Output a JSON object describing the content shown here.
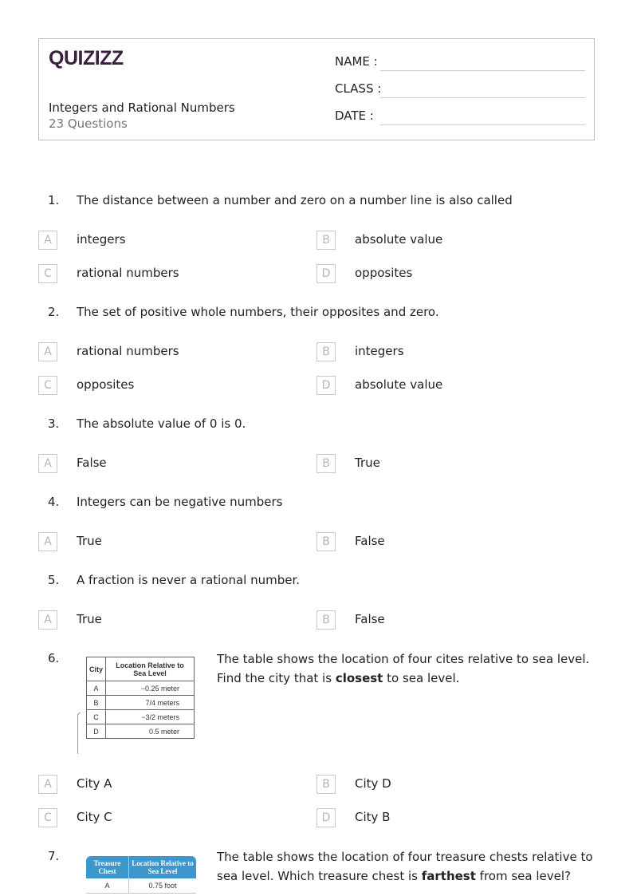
{
  "header": {
    "logo": "QUIZIZZ",
    "title": "Integers and Rational Numbers",
    "subtitle": "23 Questions",
    "fields": {
      "name": "NAME :",
      "class": "CLASS :",
      "date": "DATE  :"
    }
  },
  "questions": [
    {
      "num": "1.",
      "text": "The distance between a number and zero on a number line is also called",
      "options": [
        {
          "letter": "A",
          "text": "integers"
        },
        {
          "letter": "B",
          "text": "absolute value"
        },
        {
          "letter": "C",
          "text": "rational numbers"
        },
        {
          "letter": "D",
          "text": "opposites"
        }
      ]
    },
    {
      "num": "2.",
      "text": "The set of positive whole numbers, their opposites and zero.",
      "options": [
        {
          "letter": "A",
          "text": "rational numbers"
        },
        {
          "letter": "B",
          "text": "integers"
        },
        {
          "letter": "C",
          "text": "opposites"
        },
        {
          "letter": "D",
          "text": "absolute value"
        }
      ]
    },
    {
      "num": "3.",
      "text": "The absolute value of 0 is 0.",
      "options": [
        {
          "letter": "A",
          "text": "False"
        },
        {
          "letter": "B",
          "text": "True"
        }
      ]
    },
    {
      "num": "4.",
      "text": "Integers can be negative numbers",
      "options": [
        {
          "letter": "A",
          "text": "True"
        },
        {
          "letter": "B",
          "text": "False"
        }
      ]
    },
    {
      "num": "5.",
      "text": "A fraction is never a rational number.",
      "options": [
        {
          "letter": "A",
          "text": "True"
        },
        {
          "letter": "B",
          "text": "False"
        }
      ]
    },
    {
      "num": "6.",
      "text_pre": "The table shows the location of four cites relative to sea level. Find the city that is ",
      "text_bold": "closest",
      "text_post": " to sea level.",
      "table": {
        "headers": [
          "City",
          "Location Relative to Sea Level"
        ],
        "rows": [
          [
            "A",
            "−0.25 meter"
          ],
          [
            "B",
            "7/4 meters"
          ],
          [
            "C",
            "−3/2 meters"
          ],
          [
            "D",
            "0.5 meter"
          ]
        ]
      },
      "options": [
        {
          "letter": "A",
          "text": "City A"
        },
        {
          "letter": "B",
          "text": "City D"
        },
        {
          "letter": "C",
          "text": "City C"
        },
        {
          "letter": "D",
          "text": "City B"
        }
      ]
    },
    {
      "num": "7.",
      "text_pre": "The table shows the location of four treasure chests relative to sea level. Which treasure chest is ",
      "text_bold": "farthest",
      "text_post": " from sea level?",
      "table": {
        "headers": [
          "Treasure Chest",
          "Location Relative to Sea Level"
        ],
        "rows": [
          [
            "A",
            "0.75 foot"
          ]
        ]
      }
    }
  ]
}
